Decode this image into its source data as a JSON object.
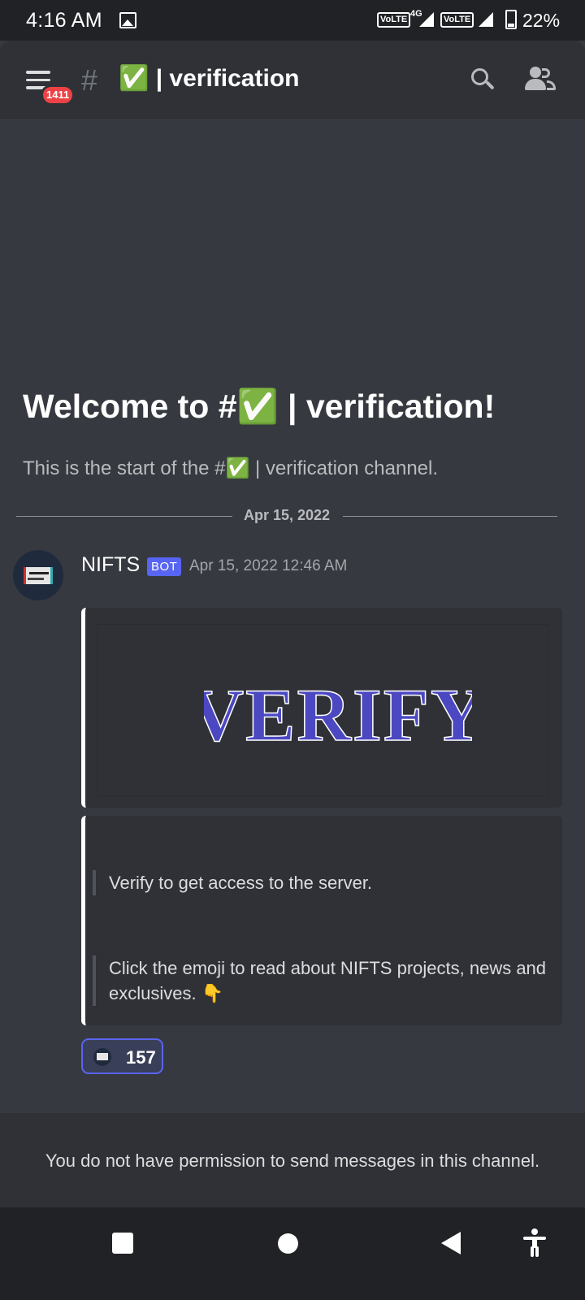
{
  "statusbar": {
    "time": "4:16 AM",
    "network_label_1": "VoLTE",
    "network_type": "4G",
    "network_label_2": "VoLTE",
    "battery": "22%"
  },
  "header": {
    "unread_badge": "1411",
    "hash": "#",
    "channel_name": "✅ | verification"
  },
  "channel_intro": {
    "title": "Welcome to #✅ | verification!",
    "subtitle": "This is the start of the #✅ | verification channel."
  },
  "divider_date": "Apr 15, 2022",
  "message": {
    "author": "NIFTS",
    "bot_tag": "BOT",
    "timestamp": "Apr 15, 2022 12:46 AM",
    "embed_image_text": "VERIFY",
    "quote_1": "Verify to get access to the server.",
    "quote_2": "Click the emoji to read about NIFTS projects, news and exclusives. 👇",
    "reaction_count": "157"
  },
  "permission_notice": "You do not have permission to send messages in this channel.",
  "colors": {
    "background": "#36393f",
    "header": "#2f3136",
    "accent": "#5865f2",
    "badge": "#ed4245",
    "verify_text": "#4b48c2"
  }
}
